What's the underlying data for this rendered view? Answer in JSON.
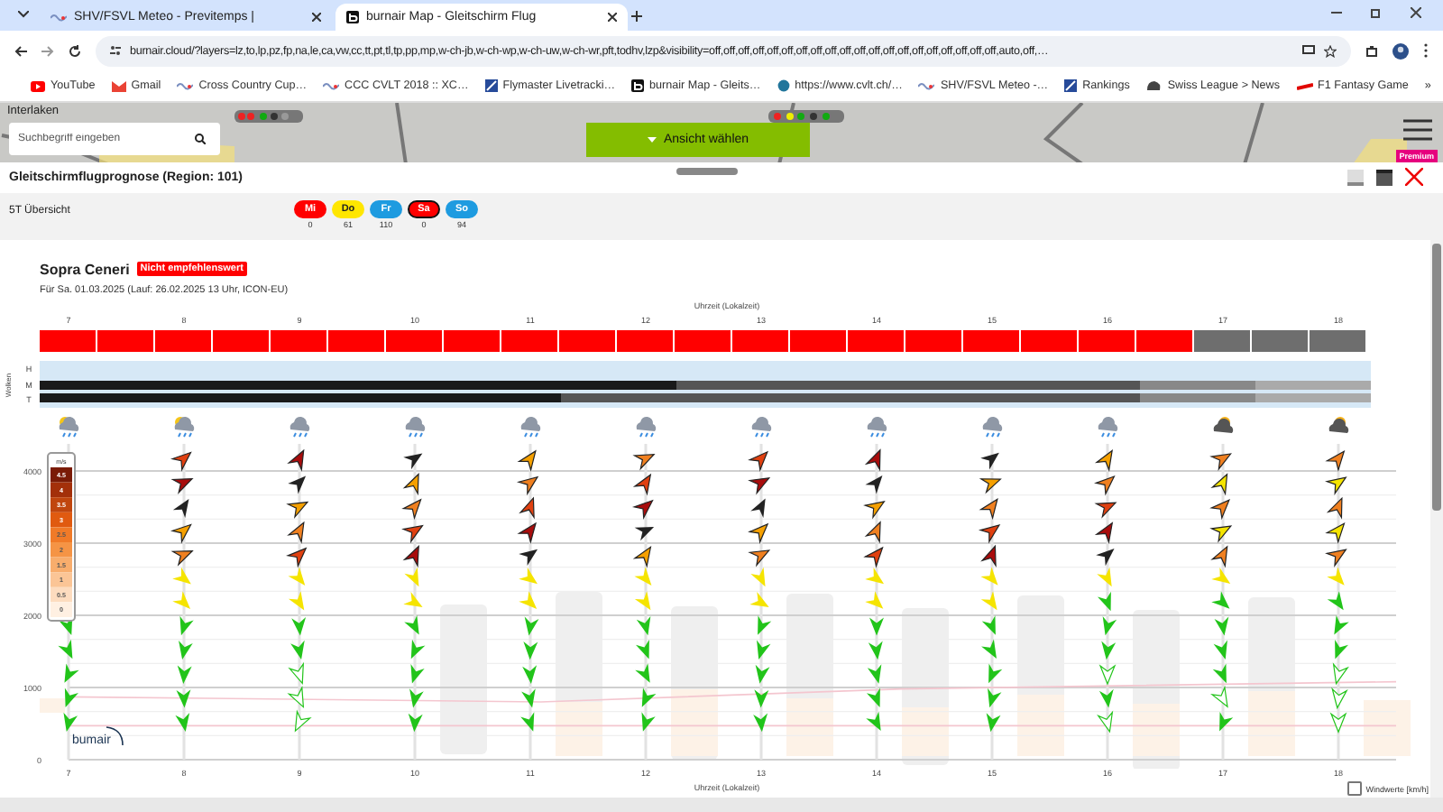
{
  "browser": {
    "tabs": [
      {
        "title": "SHV/FSVL Meteo - Previtemps |",
        "kind": "wave",
        "selected": false
      },
      {
        "title": "burnair Map - Gleitschirm Flug",
        "kind": "burnair",
        "selected": true
      }
    ],
    "address": "burnair.cloud/?layers=lz,to,lp,pz,fp,na,le,ca,vw,cc,tt,pt,tl,tp,pp,mp,w-ch-jb,w-ch-wp,w-ch-uw,w-ch-wr,pft,todhv,lzp&visibility=off,off,off,off,off,off,off,off,off,off,off,off,off,off,off,off,off,off,off,off,auto,off,…",
    "bookmarks": [
      {
        "label": "YouTube",
        "kind": "youtube"
      },
      {
        "label": "Gmail",
        "kind": "gmail"
      },
      {
        "label": "Cross Country Cup…",
        "kind": "wave"
      },
      {
        "label": "CCC CVLT 2018 :: XC…",
        "kind": "wave"
      },
      {
        "label": "Flymaster Livetracki…",
        "kind": "tile"
      },
      {
        "label": "burnair Map - Gleits…",
        "kind": "burnair"
      },
      {
        "label": "https://www.cvlt.ch/…",
        "kind": "wordpress"
      },
      {
        "label": "SHV/FSVL Meteo -…",
        "kind": "wave"
      },
      {
        "label": "Rankings",
        "kind": "tile"
      },
      {
        "label": "Swiss League > News",
        "kind": "helmet"
      },
      {
        "label": "F1 Fantasy Game",
        "kind": "dash"
      }
    ],
    "more": "»"
  },
  "map": {
    "place_label": "Interlaken",
    "search_placeholder": "Suchbegriff eingeben",
    "view_button": "Ansicht wählen",
    "premium_badge": "Premium"
  },
  "panel": {
    "title": "Gleitschirmflugprognose (Region: 101)"
  },
  "overview": {
    "label": "5T Übersicht",
    "days": [
      {
        "label": "Mi",
        "count": "0",
        "color": "#ff0000",
        "selected": false
      },
      {
        "label": "Do",
        "count": "61",
        "color": "#ffe600",
        "selected": false
      },
      {
        "label": "Fr",
        "count": "110",
        "color": "#1e9be0",
        "selected": false
      },
      {
        "label": "Sa",
        "count": "0",
        "color": "#ff0000",
        "selected": true
      },
      {
        "label": "So",
        "count": "94",
        "color": "#1e9be0",
        "selected": false
      }
    ]
  },
  "forecast": {
    "site": "Sopra Ceneri",
    "rating": "Nicht empfehlenswert",
    "subtitle": "Für Sa. 01.03.2025 (Lauf: 26.02.2025 13 Uhr, ICON-EU)",
    "axis_label": "Uhrzeit (Lokalzeit)",
    "hours": [
      "7",
      "8",
      "9",
      "10",
      "11",
      "12",
      "13",
      "14",
      "15",
      "16",
      "17",
      "18"
    ],
    "flyability": [
      {
        "color": "#ff0000"
      },
      {
        "color": "#ff0000"
      },
      {
        "color": "#ff0000"
      },
      {
        "color": "#ff0000"
      },
      {
        "color": "#ff0000"
      },
      {
        "color": "#ff0000"
      },
      {
        "color": "#ff0000"
      },
      {
        "color": "#ff0000"
      },
      {
        "color": "#ff0000"
      },
      {
        "color": "#ff0000"
      },
      {
        "color": "#ff0000"
      },
      {
        "color": "#ff0000"
      },
      {
        "color": "#ff0000"
      },
      {
        "color": "#ff0000"
      },
      {
        "color": "#ff0000"
      },
      {
        "color": "#ff0000"
      },
      {
        "color": "#ff0000"
      },
      {
        "color": "#ff0000"
      },
      {
        "color": "#ff0000"
      },
      {
        "color": "#ff0000"
      },
      {
        "color": "#6e6e6e"
      },
      {
        "color": "#6e6e6e"
      },
      {
        "color": "#6e6e6e"
      }
    ]
  },
  "clouds": {
    "label": "Wolken",
    "layers": [
      {
        "label": "H",
        "kind": "clear"
      },
      {
        "label": "M",
        "kind": "dense"
      },
      {
        "label": "T",
        "kind": "dense"
      }
    ]
  },
  "wind": {
    "yticks": [
      "4000",
      "3000",
      "2000",
      "1000",
      "0"
    ],
    "legend": {
      "unit": "m/s",
      "values": [
        "4.5",
        "4",
        "3.5",
        "3",
        "2.5",
        "2",
        "1.5",
        "1",
        "0.5",
        "0"
      ]
    },
    "columns": [
      {
        "hour": "7",
        "kind": "sun-showers"
      },
      {
        "hour": "8",
        "kind": "sun-showers"
      },
      {
        "hour": "9",
        "kind": "showers"
      },
      {
        "hour": "10",
        "kind": "showers"
      },
      {
        "hour": "11",
        "kind": "showers"
      },
      {
        "hour": "12",
        "kind": "showers"
      },
      {
        "hour": "13",
        "kind": "showers"
      },
      {
        "hour": "14",
        "kind": "showers"
      },
      {
        "hour": "15",
        "kind": "showers"
      },
      {
        "hour": "16",
        "kind": "showers"
      },
      {
        "hour": "17",
        "kind": "sun-cloud"
      },
      {
        "hour": "18",
        "kind": "sun-cloud"
      }
    ],
    "axis_label": "Uhrzeit (Lokalzeit)",
    "logo": "bumair",
    "toggle": {
      "label": "Windwerte [km/h]",
      "checked": false
    }
  }
}
